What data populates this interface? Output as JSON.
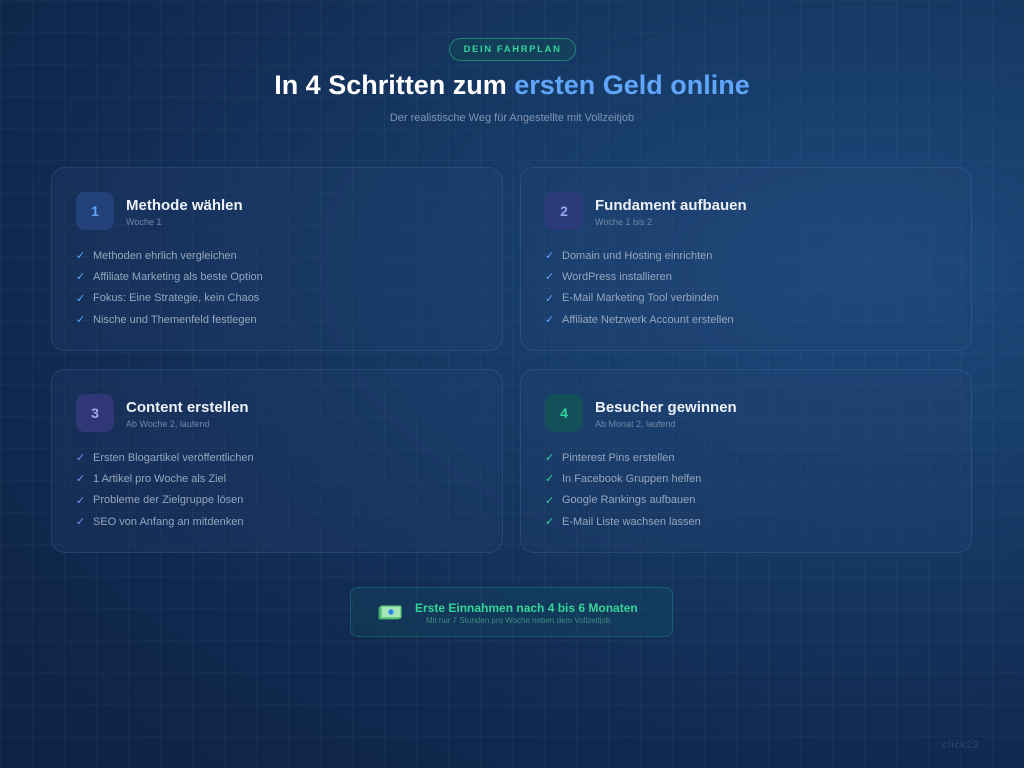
{
  "header": {
    "badge": "DEIN FAHRPLAN",
    "title_prefix": "In 4 Schritten zum ",
    "title_highlight": "ersten Geld online",
    "subtitle": "Der realistische Weg für Angestellte mit Vollzeitjob"
  },
  "steps": [
    {
      "number": "1",
      "title": "Methode wählen",
      "timeframe": "Woche 1",
      "items": [
        "Methoden ehrlich vergleichen",
        "Affiliate Marketing als beste Option",
        "Fokus: Eine Strategie, kein Chaos",
        "Nische und Themenfeld festlegen"
      ]
    },
    {
      "number": "2",
      "title": "Fundament aufbauen",
      "timeframe": "Woche 1 bis 2",
      "items": [
        "Domain und Hosting einrichten",
        "WordPress installieren",
        "E-Mail Marketing Tool verbinden",
        "Affiliate Netzwerk Account erstellen"
      ]
    },
    {
      "number": "3",
      "title": "Content erstellen",
      "timeframe": "Ab Woche 2, laufend",
      "items": [
        "Ersten Blogartikel veröffentlichen",
        "1 Artikel pro Woche als Ziel",
        "Probleme der Zielgruppe lösen",
        "SEO von Anfang an mitdenken"
      ]
    },
    {
      "number": "4",
      "title": "Besucher gewinnen",
      "timeframe": "Ab Monat 2, laufend",
      "items": [
        "Pinterest Pins erstellen",
        "In Facebook Gruppen helfen",
        "Google Rankings aufbauen",
        "E-Mail Liste wachsen lassen"
      ]
    }
  ],
  "check_mark": "✓",
  "footer": {
    "icon": "money-icon",
    "title": "Erste Einnahmen nach 4 bis 6 Monaten",
    "subtitle": "Mit nur 7 Stunden pro Woche neben dem Vollzeitjob"
  },
  "watermark": "click23",
  "colors": {
    "accent_blue": "#60a5fa",
    "accent_green": "#34d399",
    "accent_indigo": "#818cf8",
    "background": "#13305a"
  }
}
